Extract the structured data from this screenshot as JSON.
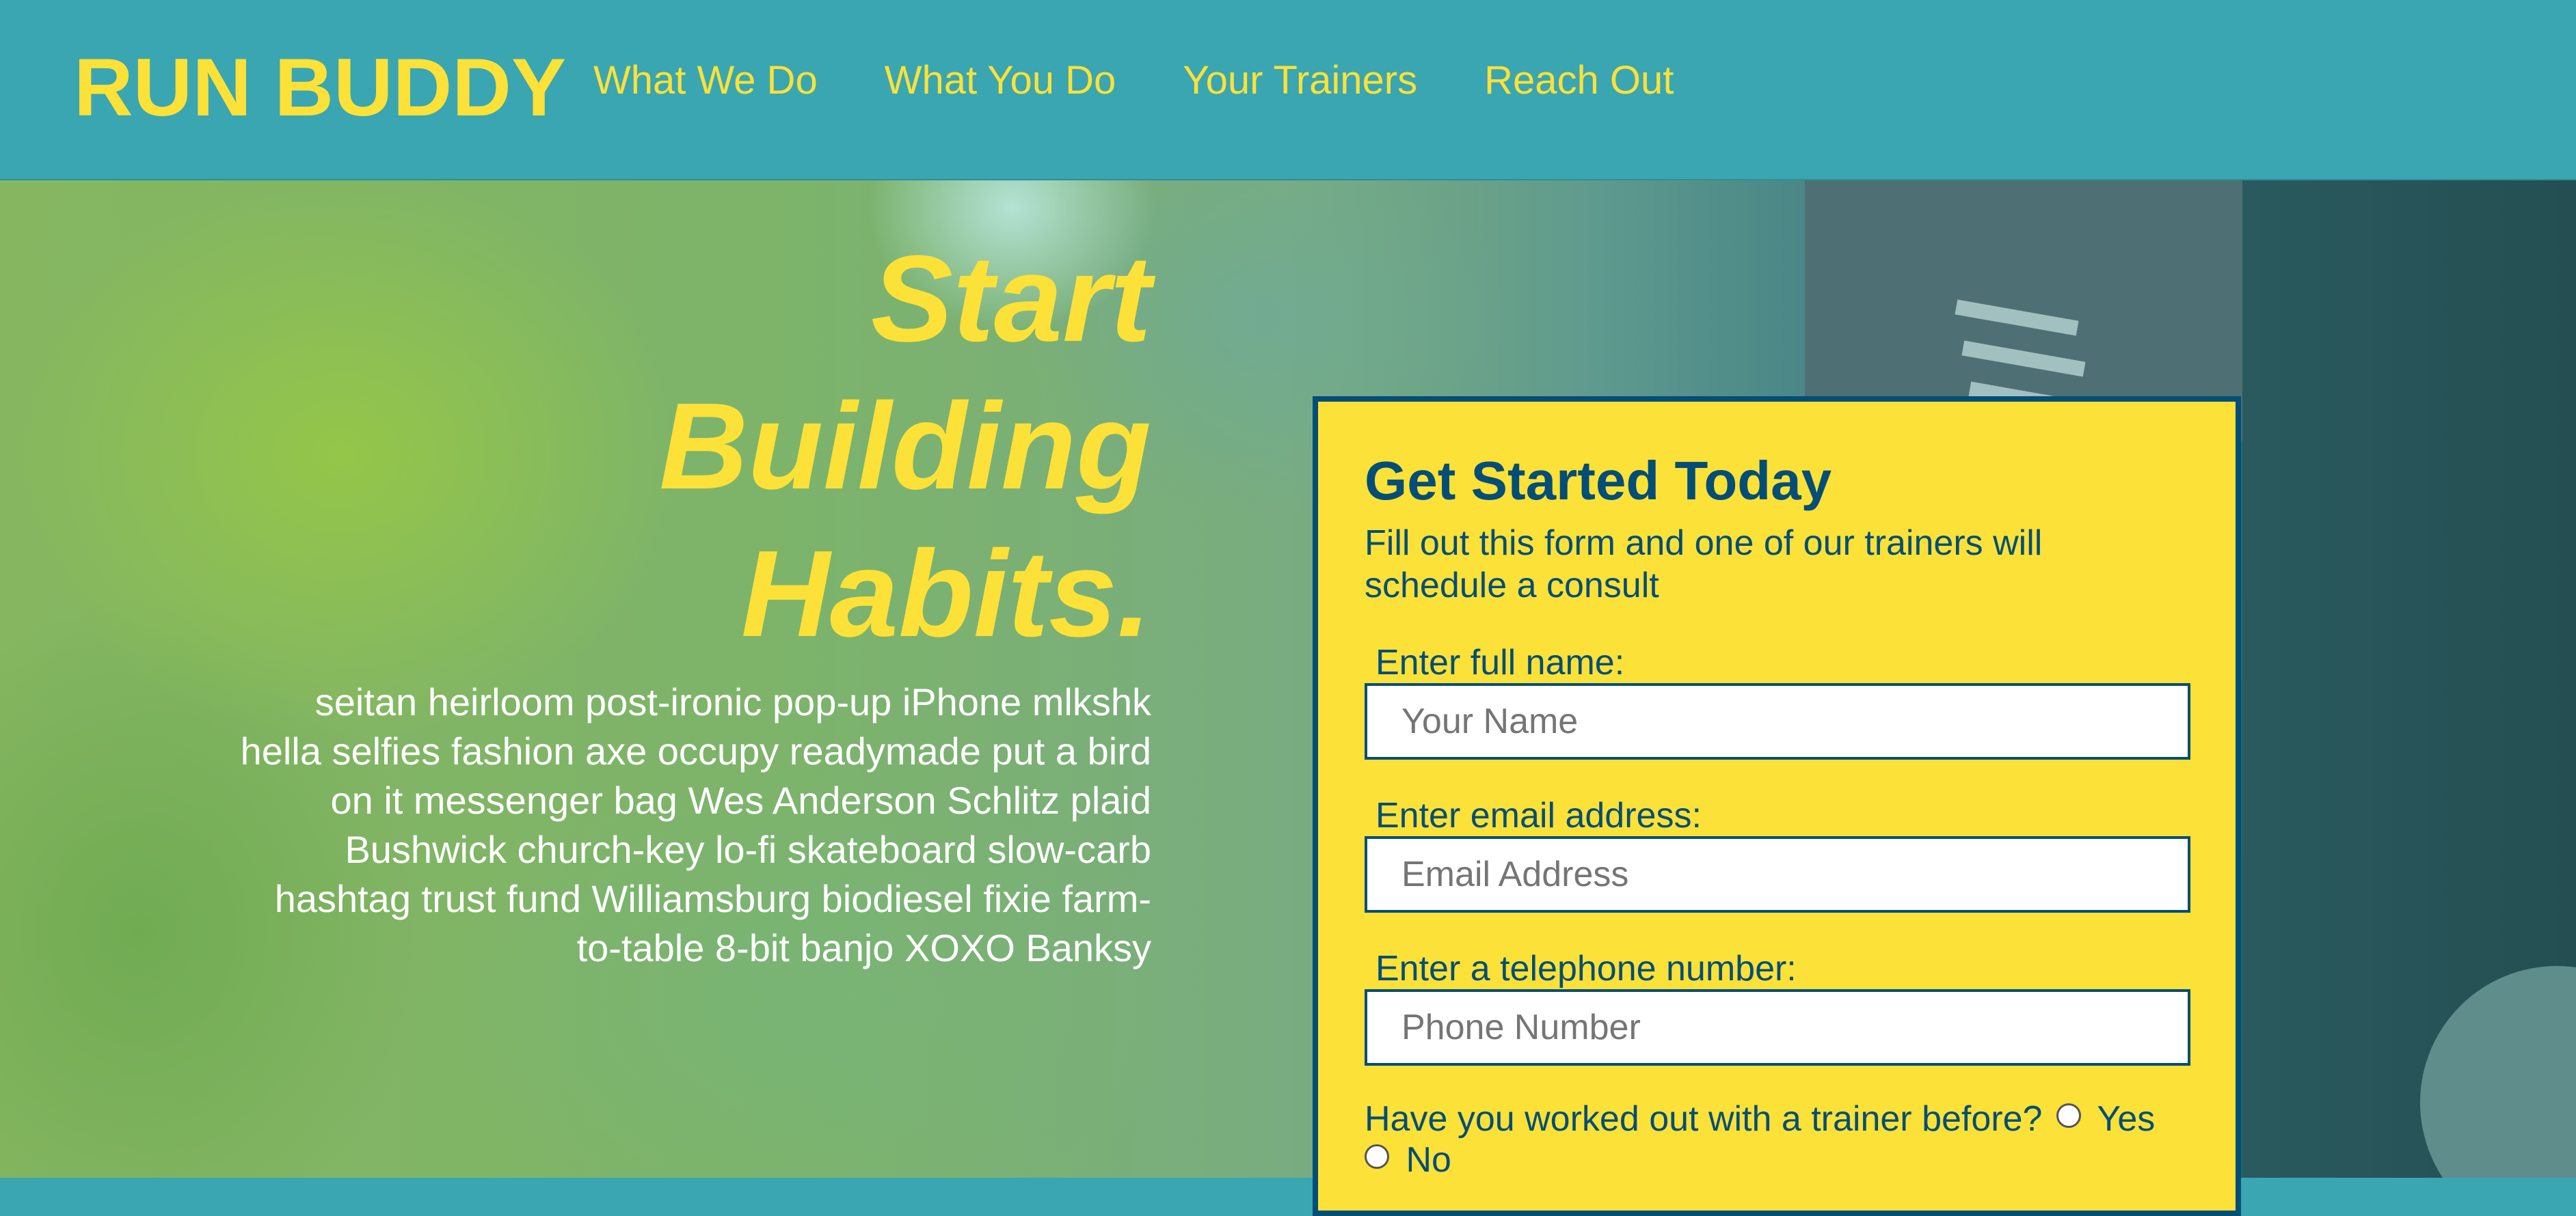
{
  "header": {
    "logo": "RUN BUDDY",
    "nav": [
      "What We Do",
      "What You Do",
      "Your Trainers",
      "Reach Out"
    ]
  },
  "hero": {
    "title_lines": [
      "Start",
      "Building",
      "Habits."
    ],
    "body": "seitan heirloom post-ironic pop-up iPhone mlkshk hella selfies fashion axe occupy readymade put a bird on it messenger bag Wes Anderson Schlitz plaid Bushwick church-key lo-fi skateboard slow-carb hashtag trust fund Williamsburg biodiesel fixie farm-to-table 8-bit banjo XOXO Banksy"
  },
  "form": {
    "title": "Get Started Today",
    "subtitle": "Fill out this form and one of our trainers will schedule a consult",
    "name_label": "Enter full name:",
    "name_placeholder": "Your Name",
    "email_label": "Enter email address:",
    "email_placeholder": "Email Address",
    "phone_label": "Enter a telephone number:",
    "phone_placeholder": "Phone Number",
    "trainer_question": "Have you worked out with a trainer before?",
    "option_yes": "Yes",
    "option_no": "No"
  },
  "colors": {
    "primary": "#39a6b2",
    "accent": "#fce138",
    "dark": "#024e76"
  }
}
